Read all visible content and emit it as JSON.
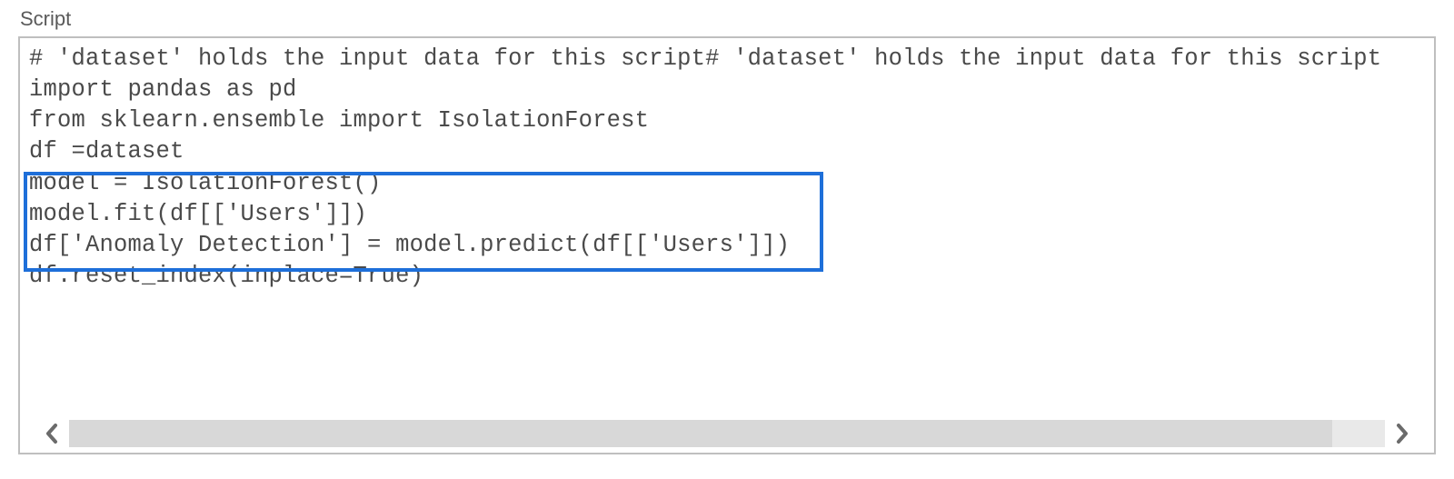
{
  "label": "Script",
  "code_lines": [
    "# 'dataset' holds the input data for this script# 'dataset' holds the input data for this script",
    "import pandas as pd",
    "from sklearn.ensemble import IsolationForest",
    "df =dataset",
    "model = IsolationForest()",
    "model.fit(df[['Users']])",
    "df['Anomaly Detection'] = model.predict(df[['Users']])",
    "df.reset_index(inplace=True)"
  ]
}
